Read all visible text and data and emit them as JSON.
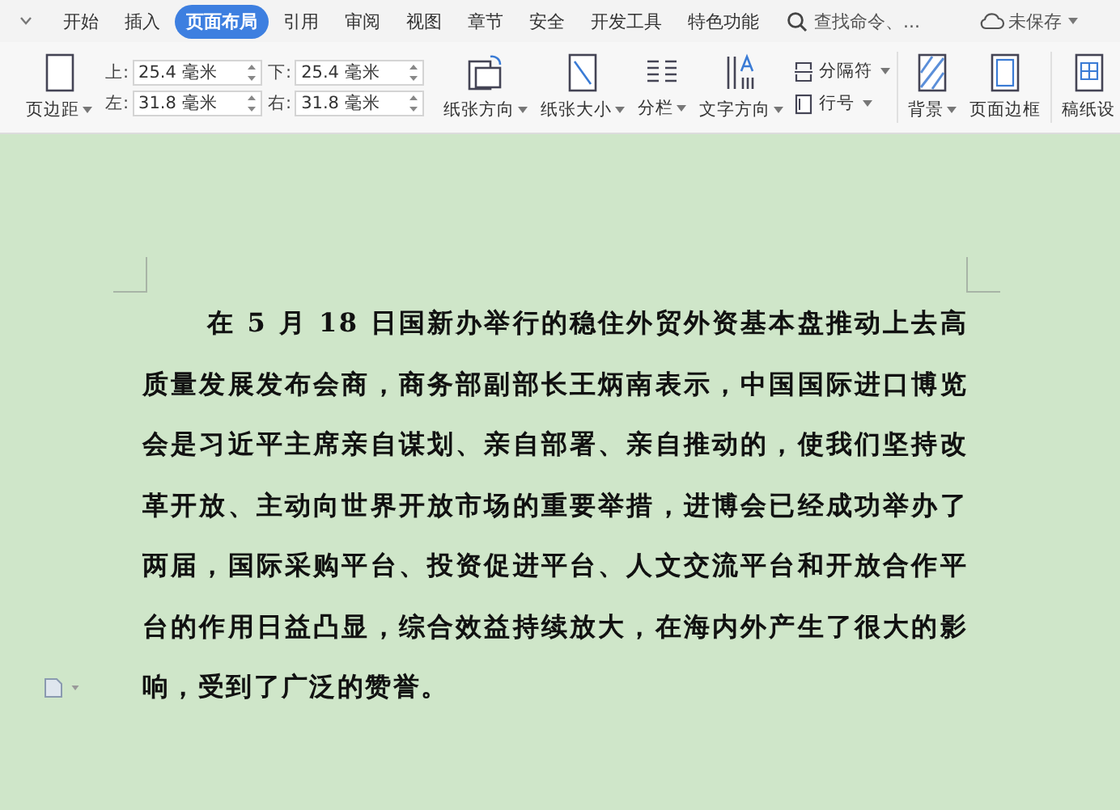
{
  "tabs": [
    {
      "label": "开始",
      "selected": false
    },
    {
      "label": "插入",
      "selected": false
    },
    {
      "label": "页面布局",
      "selected": true
    },
    {
      "label": "引用",
      "selected": false
    },
    {
      "label": "审阅",
      "selected": false
    },
    {
      "label": "视图",
      "selected": false
    },
    {
      "label": "章节",
      "selected": false
    },
    {
      "label": "安全",
      "selected": false
    },
    {
      "label": "开发工具",
      "selected": false
    },
    {
      "label": "特色功能",
      "selected": false
    }
  ],
  "search": {
    "placeholder": "查找命令、..."
  },
  "save_status": {
    "label": "未保存",
    "dropdown": true
  },
  "ribbon": {
    "margin_button": {
      "label": "页边距",
      "dropdown": true
    },
    "margins": [
      {
        "label": "上:",
        "value": "25.4 毫米"
      },
      {
        "label": "下:",
        "value": "25.4 毫米"
      },
      {
        "label": "左:",
        "value": "31.8 毫米"
      },
      {
        "label": "右:",
        "value": "31.8 毫米"
      }
    ],
    "buttons": [
      {
        "kind": "orientation",
        "label": "纸张方向",
        "dropdown": true
      },
      {
        "kind": "size",
        "label": "纸张大小",
        "dropdown": true
      },
      {
        "kind": "columns",
        "label": "分栏",
        "dropdown": true
      },
      {
        "kind": "direction",
        "label": "文字方向",
        "dropdown": true
      }
    ],
    "small_buttons": [
      {
        "kind": "break",
        "label": "分隔符",
        "dropdown": true
      },
      {
        "kind": "linenumber",
        "label": "行号",
        "dropdown": true
      }
    ],
    "buttons_2": [
      {
        "kind": "background",
        "label": "背景",
        "dropdown": true
      },
      {
        "kind": "border",
        "label": "页面边框",
        "dropdown": false
      }
    ],
    "buttons_3": [
      {
        "kind": "grid",
        "label": "稿纸设",
        "dropdown": false
      }
    ]
  },
  "document": {
    "paragraph": "在 5 月 18 日国新办举行的稳住外贸外资基本盘推动上去高质量发展发布会商，商务部副部长王炳南表示，中国国际进口博览会是习近平主席亲自谋划、亲自部署、亲自推动的，使我们坚持改革开放、主动向世界开放市场的重要举措，进博会已经成功举办了两届，国际采购平台、投资促进平台、人文交流平台和开放合作平台的作用日益凸显，综合效益持续放大，在海内外产生了很大的影响，受到了广泛的赞誉。"
  }
}
